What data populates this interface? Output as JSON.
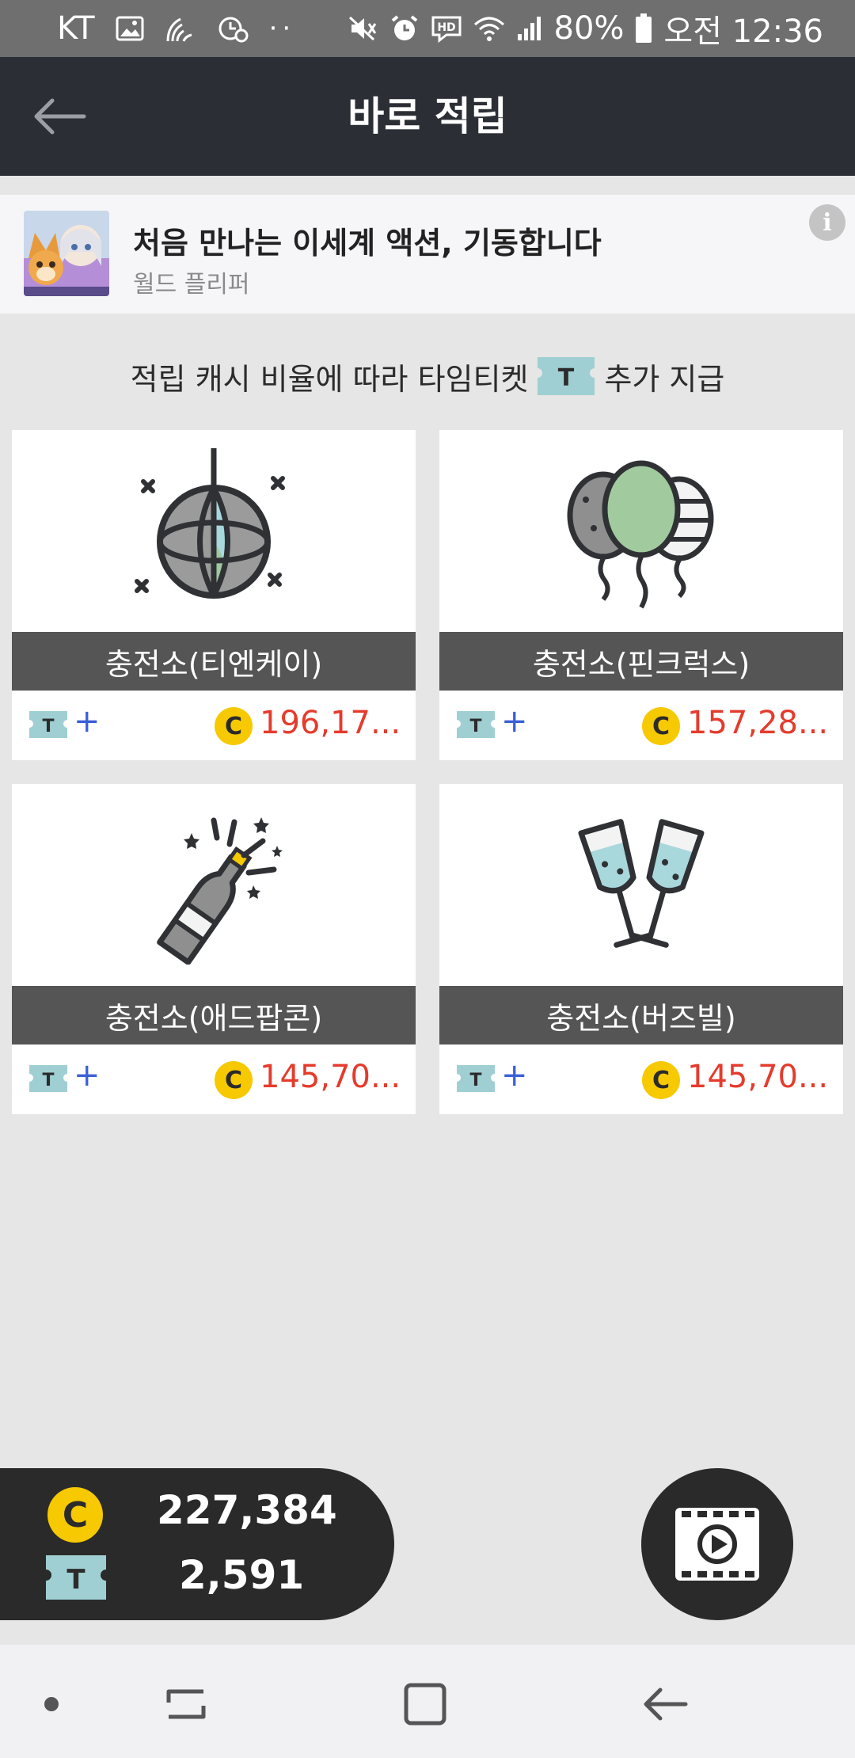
{
  "status_bar": {
    "carrier": "KT",
    "battery": "80%",
    "time": "오전 12:36"
  },
  "app_bar": {
    "title": "바로 적립"
  },
  "ad": {
    "title": "처음 만나는 이세계 액션, 기동합니다",
    "subtitle": "월드 플리퍼"
  },
  "notice": {
    "prefix": "적립 캐시 비율에 따라 타임티켓",
    "suffix": "추가 지급"
  },
  "cards": [
    {
      "label": "충전소(티엔케이)",
      "icon": "disco-ball-icon",
      "plus": "+",
      "value": "196,17..."
    },
    {
      "label": "충전소(핀크럭스)",
      "icon": "balloons-icon",
      "plus": "+",
      "value": "157,28..."
    },
    {
      "label": "충전소(애드팝콘)",
      "icon": "champagne-bottle-icon",
      "plus": "+",
      "value": "145,70..."
    },
    {
      "label": "충전소(버즈빌)",
      "icon": "champagne-glasses-icon",
      "plus": "+",
      "value": "145,70..."
    }
  ],
  "balance": {
    "coin": "227,384",
    "ticket": "2,591"
  },
  "colors": {
    "app_bar": "#2b2f35",
    "coin_yellow": "#f6c900",
    "ticket_teal": "#9fcfd3",
    "value_red": "#e53b2c",
    "plus_blue": "#3a5fd8",
    "card_label_bg": "#555555"
  }
}
